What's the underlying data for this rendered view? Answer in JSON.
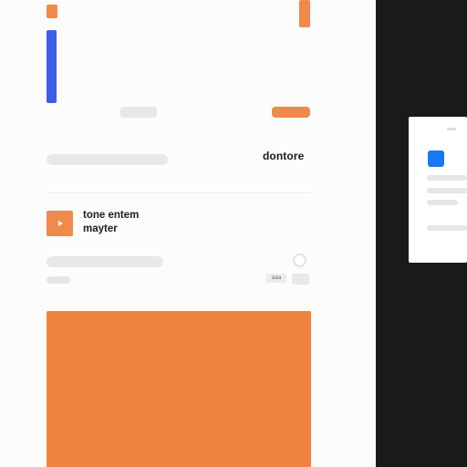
{
  "header": {
    "label": "dontore"
  },
  "media": {
    "title": "tone entem mayter",
    "play_icon": "play-icon"
  },
  "chip": {
    "label": "aaa"
  },
  "colors": {
    "accent": "#f08a4b",
    "hero": "#f0843f",
    "blue_bar": "#3d5ee6",
    "side_chip": "#1877f2",
    "dark_panel": "#1a1a1a"
  }
}
